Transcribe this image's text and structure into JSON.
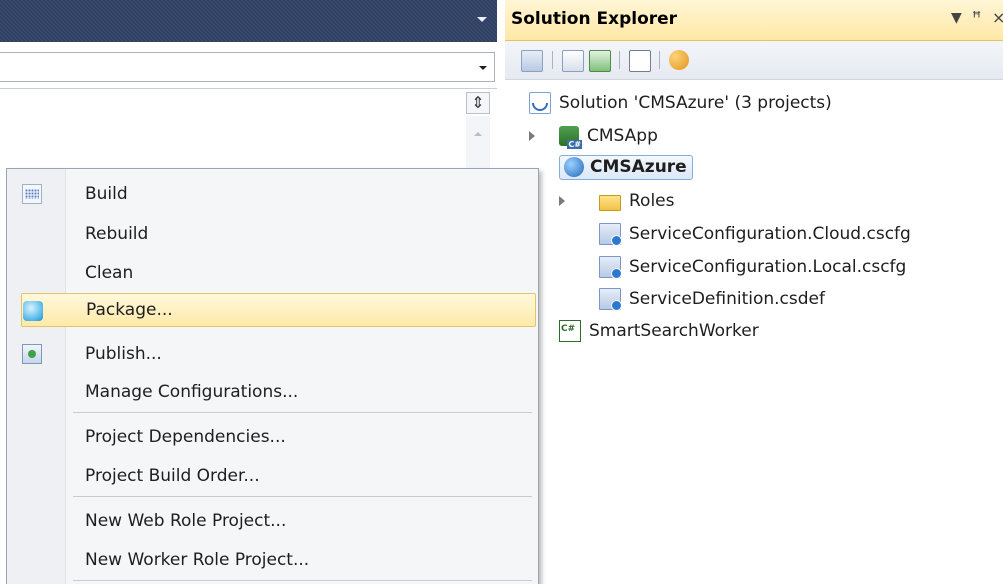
{
  "solution_explorer": {
    "title": "Solution Explorer",
    "title_controls": {
      "dropdown": "▼",
      "pin": "ꟷ",
      "close": "×"
    },
    "toolbar_icons": [
      "properties-icon",
      "show-all-files-icon",
      "refresh-icon",
      "view-code-icon",
      "class-diagram-icon"
    ],
    "tree": {
      "solution": "Solution 'CMSAzure' (3 projects)",
      "items": [
        {
          "label": "CMSApp",
          "icon": "csharp-web-project-icon",
          "expandable": true
        },
        {
          "label": "CMSAzure",
          "icon": "azure-globe-icon",
          "selected": true
        },
        {
          "label": "Roles",
          "icon": "folder-icon",
          "expandable": true
        },
        {
          "label": "ServiceConfiguration.Cloud.cscfg",
          "icon": "config-file-icon"
        },
        {
          "label": "ServiceConfiguration.Local.cscfg",
          "icon": "config-file-icon"
        },
        {
          "label": "ServiceDefinition.csdef",
          "icon": "definition-file-icon"
        },
        {
          "label": "SmartSearchWorker",
          "icon": "csharp-project-icon"
        }
      ]
    }
  },
  "context_menu": {
    "items": [
      {
        "label": "Build",
        "icon": "build-icon"
      },
      {
        "label": "Rebuild"
      },
      {
        "label": "Clean"
      },
      {
        "label": "Package...",
        "icon": "package-icon",
        "highlighted": true
      },
      {
        "label": "Publish...",
        "icon": "publish-icon"
      },
      {
        "label": "Manage Configurations..."
      },
      {
        "label": "Project Dependencies..."
      },
      {
        "label": "Project Build Order..."
      },
      {
        "label": "New Web Role Project..."
      },
      {
        "label": "New Worker Role Project..."
      }
    ]
  },
  "colors": {
    "editor_titlebar": "#2f3f62",
    "se_titlebar": "#ffe8a6",
    "menu_highlight": "#fdeaa8",
    "selection": "#dbe8f8"
  }
}
